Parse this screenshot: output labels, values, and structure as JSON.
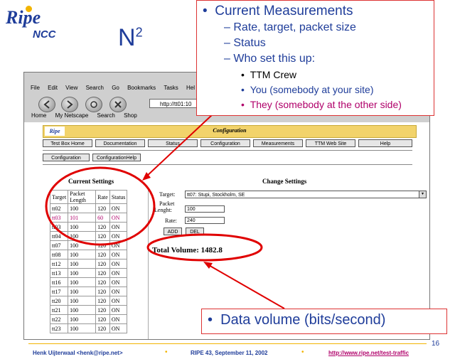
{
  "slide": {
    "title_main": "N",
    "title_sup": "2",
    "logo_text": "Ripe",
    "logo_sub": "NCC",
    "page_number": "16"
  },
  "callout_top": {
    "heading": "Current Measurements",
    "sub1": "Rate, target, packet size",
    "sub2": "Status",
    "sub3": "Who set this up:",
    "item1": "TTM Crew",
    "item2": "You (somebody at your site)",
    "item3": "They (somebody at the other side)",
    "bullet": "•",
    "dash": "–"
  },
  "callout_bottom": {
    "text": "Data volume (bits/second)"
  },
  "browser": {
    "menu": [
      "File",
      "Edit",
      "View",
      "Search",
      "Go",
      "Bookmarks",
      "Tasks",
      "Hel"
    ],
    "url": "http://tt01:10",
    "bookmarks": [
      "Home",
      "My Netscape",
      "Search",
      "Shop"
    ]
  },
  "page": {
    "logo": "Ripe",
    "header": "Configuration",
    "tabs": [
      "Test Box Home",
      "Documentation",
      "Status",
      "Configuration",
      "Measurements",
      "TTM Web Site",
      "Help"
    ],
    "subtabs": [
      "Configuration",
      "ConfigurationHelp"
    ],
    "current_title": "Current Settings",
    "change_title": "Change Settings",
    "table_headers": [
      "Target",
      "Packet Length",
      "Rate",
      "Status"
    ],
    "rows": [
      [
        "tt02",
        "100",
        "120",
        "ON"
      ],
      [
        "tt03",
        "101",
        "60",
        "ON"
      ],
      [
        "tt03",
        "100",
        "120",
        "ON"
      ],
      [
        "tt04",
        "100",
        "120",
        "ON"
      ],
      [
        "tt07",
        "100",
        "120",
        "ON"
      ],
      [
        "tt08",
        "100",
        "120",
        "ON"
      ],
      [
        "tt12",
        "100",
        "120",
        "ON"
      ],
      [
        "tt13",
        "100",
        "120",
        "ON"
      ],
      [
        "tt16",
        "100",
        "120",
        "ON"
      ],
      [
        "tt17",
        "100",
        "120",
        "ON"
      ],
      [
        "tt20",
        "100",
        "120",
        "ON"
      ],
      [
        "tt21",
        "100",
        "120",
        "ON"
      ],
      [
        "tt22",
        "100",
        "120",
        "ON"
      ],
      [
        "tt23",
        "100",
        "120",
        "ON"
      ]
    ],
    "highlight_row": 1,
    "target_label": "Target:",
    "target_value": "tt07: Stupi, Stockholm, SE",
    "packet_label_1": "Packet",
    "packet_label_2": "Lenght:",
    "packet_value": "100",
    "rate_label": "Rate:",
    "rate_value": "240",
    "add_label": "ADD",
    "del_label": "DEL",
    "total_volume": "Total Volume: 1482.8"
  },
  "footer": {
    "author": "Henk Uijterwaal <henk@ripe.net>",
    "event": "RIPE 43, September 11, 2002",
    "url": "http://www.ripe.net/test-traffic"
  },
  "colors": {
    "blue": "#1f3d9a",
    "magenta": "#b0006a",
    "red": "#d33",
    "gold": "#f2b400"
  }
}
